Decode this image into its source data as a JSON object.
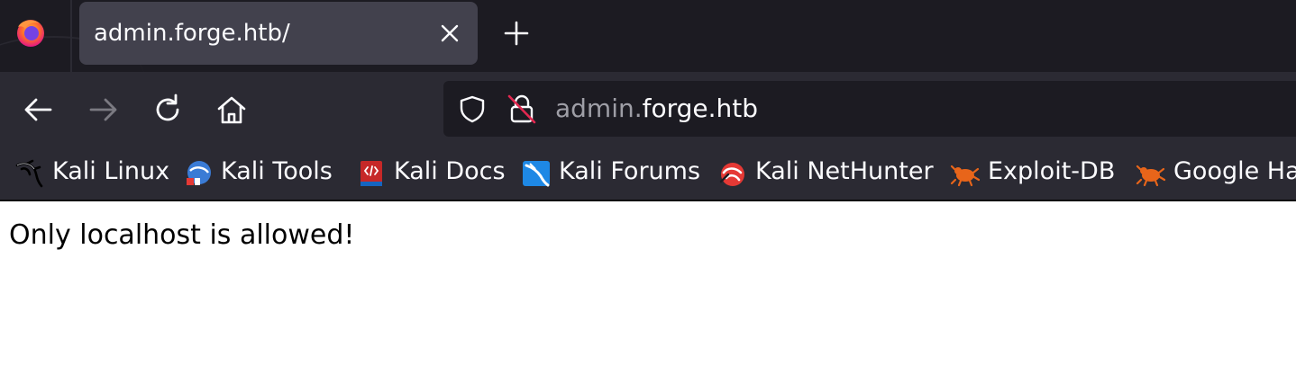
{
  "browser": {
    "tab": {
      "title": "admin.forge.htb/"
    },
    "urlbar": {
      "subdomain": "admin.",
      "domain": "forge.htb"
    },
    "icons": [
      "firefox-logo",
      "close-icon",
      "plus-icon",
      "back-arrow-icon",
      "forward-arrow-icon",
      "reload-icon",
      "home-icon",
      "shield-icon",
      "insecure-lock-icon"
    ]
  },
  "bookmarks": [
    {
      "label": "Kali Linux",
      "icon": "kali-dragon-icon"
    },
    {
      "label": "Kali Tools",
      "icon": "kali-tools-icon"
    },
    {
      "label": "Kali Docs",
      "icon": "kali-docs-icon"
    },
    {
      "label": "Kali Forums",
      "icon": "kali-forums-icon"
    },
    {
      "label": "Kali NetHunter",
      "icon": "kali-nethunter-icon"
    },
    {
      "label": "Exploit-DB",
      "icon": "exploit-db-icon"
    },
    {
      "label": "Google Ha",
      "icon": "google-hacking-db-icon"
    }
  ],
  "page": {
    "message": "Only localhost is allowed!"
  }
}
